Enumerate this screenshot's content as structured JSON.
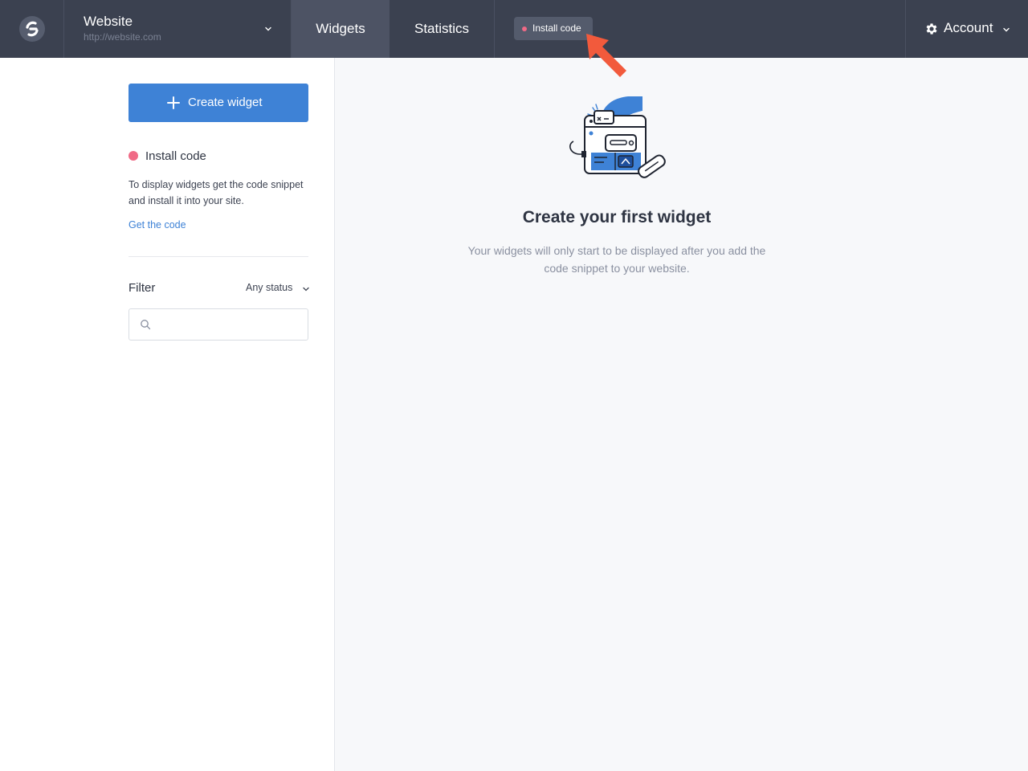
{
  "colors": {
    "topbar": "#3b4150",
    "accent": "#3e82d6",
    "status_dot": "#f06a86",
    "pointer": "#f25a3c"
  },
  "topbar": {
    "logo_icon": "logo-icon",
    "site": {
      "name": "Website",
      "url": "http://website.com",
      "chevron_icon": "chevron-down-icon"
    },
    "tabs": [
      {
        "label": "Widgets",
        "active": true
      },
      {
        "label": "Statistics",
        "active": false
      }
    ],
    "install_badge": {
      "label": "Install code",
      "pointer_icon": "arrow-pointer-icon"
    },
    "account": {
      "label": "Account",
      "icon": "gear-icon",
      "chevron_icon": "chevron-down-icon"
    }
  },
  "sidebar": {
    "create_button": {
      "label": "Create widget",
      "icon": "plus-icon"
    },
    "install": {
      "title": "Install code",
      "description": "To display widgets get the code snippet and install it into your site.",
      "link": "Get the code"
    },
    "filter": {
      "label": "Filter",
      "status_value": "Any status",
      "search_icon": "search-icon",
      "search_value": "",
      "search_placeholder": ""
    }
  },
  "main": {
    "illustration_icon": "website-widget-illustration",
    "empty_title": "Create your first widget",
    "empty_description": "Your widgets will only start to be displayed after you add the code snippet to your website."
  }
}
